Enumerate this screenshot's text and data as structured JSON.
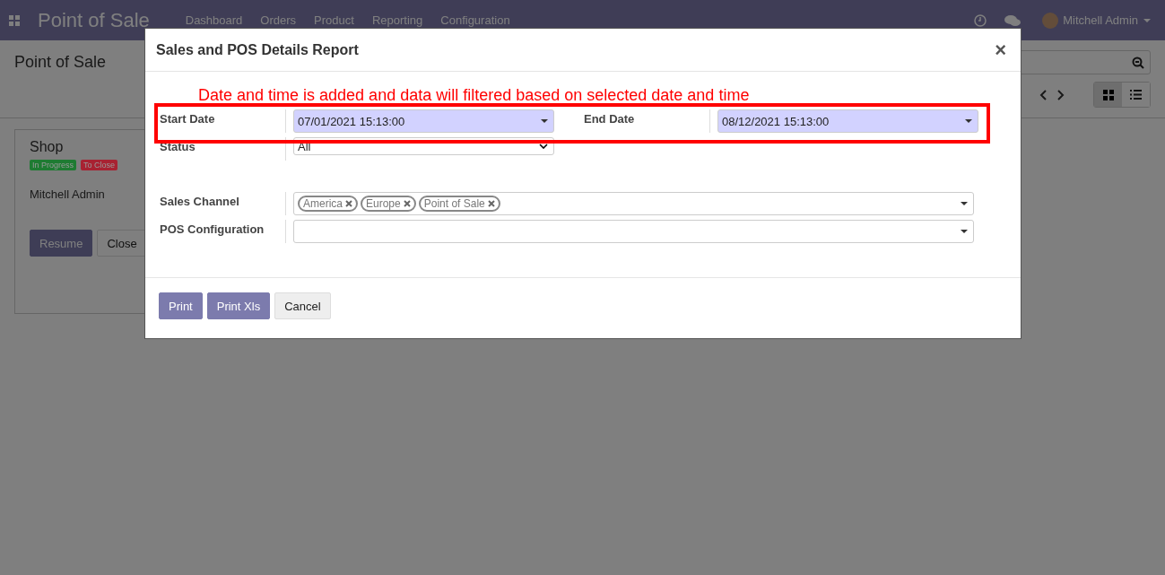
{
  "navbar": {
    "app_title": "Point of Sale",
    "menu": [
      "Dashboard",
      "Orders",
      "Product",
      "Reporting",
      "Configuration"
    ],
    "user": "Mitchell Admin"
  },
  "control_panel": {
    "breadcrumb": "Point of Sale"
  },
  "kanban_card": {
    "title": "Shop",
    "badges": [
      {
        "label": "In Progress",
        "color": "#1e7b32"
      },
      {
        "label": "To Close",
        "color": "#a82232"
      }
    ],
    "user": "Mitchell Admin",
    "buttons": [
      {
        "label": "Resume",
        "kind": "primary"
      },
      {
        "label": "Close",
        "kind": "secondary"
      }
    ]
  },
  "dialog": {
    "title": "Sales and POS Details Report",
    "close_glyph": "×",
    "note": "Date and time is added and data will filtered based on selected date and time",
    "left_fields": [
      {
        "kind": "date",
        "label": "Start Date",
        "value": "07/01/2021 15:13:00"
      },
      {
        "kind": "select",
        "label": "Status",
        "value": "All"
      }
    ],
    "right_fields": [
      {
        "kind": "date",
        "label": "End Date",
        "value": "08/12/2021 15:13:00"
      }
    ],
    "wide_fields": [
      {
        "kind": "tags",
        "label": "Sales Channel",
        "tags": [
          "America",
          "Europe",
          "Point of Sale"
        ]
      },
      {
        "kind": "many2one",
        "label": "POS Configuration"
      }
    ],
    "buttons": [
      {
        "label": "Print",
        "kind": "primary"
      },
      {
        "label": "Print Xls",
        "kind": "primary"
      },
      {
        "label": "Cancel",
        "kind": "secondary"
      }
    ]
  }
}
